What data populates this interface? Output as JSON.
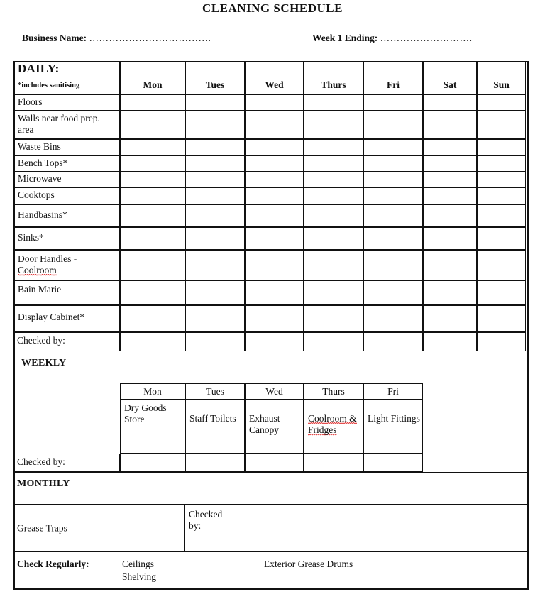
{
  "document": {
    "title": "CLEANING SCHEDULE"
  },
  "header": {
    "business_name_label": "Business Name:",
    "business_name_dots": "……………………………….",
    "week_ending_label": "Week 1 Ending:",
    "week_ending_dots": "………………………."
  },
  "daily": {
    "section_title": "DAILY:",
    "section_subtitle": "*includes sanitising",
    "day_headers": [
      "Mon",
      "Tues",
      "Wed",
      "Thurs",
      "Fri",
      "Sat",
      "Sun"
    ],
    "rows": [
      {
        "label": "Floors"
      },
      {
        "label": "Walls near food prep. area"
      },
      {
        "label": "Waste Bins"
      },
      {
        "label": "Bench Tops*"
      },
      {
        "label": "Microwave"
      },
      {
        "label": "Cooktops"
      },
      {
        "label": "Handbasins*"
      },
      {
        "label": "Sinks*"
      },
      {
        "label_line1": "Door Handles -",
        "label_line2": "Coolroom",
        "misspelled": true
      },
      {
        "label": "Bain Marie"
      },
      {
        "label": "Display Cabinet*"
      },
      {
        "label": "Checked by:"
      }
    ]
  },
  "weekly": {
    "section_title": "WEEKLY",
    "day_headers": [
      "Mon",
      "Tues",
      "Wed",
      "Thurs",
      "Fri"
    ],
    "tasks": [
      {
        "text": "Dry Goods Store"
      },
      {
        "text": "Staff Toilets"
      },
      {
        "text": "Exhaust Canopy"
      },
      {
        "text": "Coolroom & Fridges",
        "misspelled": true
      },
      {
        "text": "Light Fittings"
      }
    ],
    "checked_by_label": "Checked by:"
  },
  "monthly": {
    "section_title": "MONTHLY",
    "task_label": "Grease Traps",
    "checked_by_label": "Checked by:"
  },
  "check_regularly": {
    "label": "Check Regularly:",
    "item1_line1": "Ceilings",
    "item1_line2": "Shelving",
    "item2": "Exterior Grease Drums"
  },
  "colors": {
    "ink": "#111111",
    "spellcheck": "#e03030",
    "paper": "#ffffff"
  }
}
